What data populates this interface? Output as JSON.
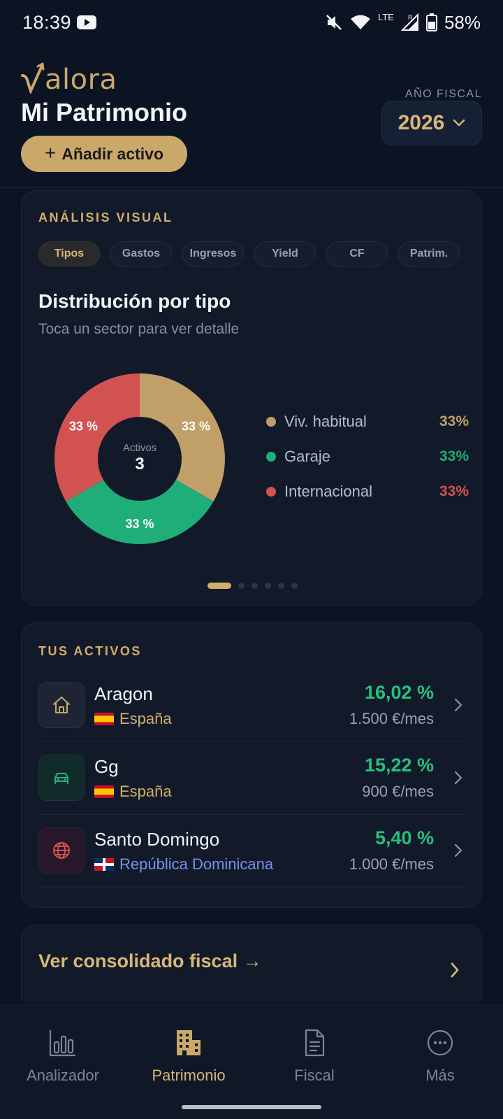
{
  "status_bar": {
    "time": "18:39",
    "network": "LTE",
    "roaming": "R",
    "battery": "58%"
  },
  "header": {
    "logo_text": "alora",
    "title": "Mi Patrimonio",
    "add_button": "Añadir activo",
    "fiscal_label": "AÑO FISCAL",
    "fiscal_year": "2026"
  },
  "analysis": {
    "section_label": "ANÁLISIS VISUAL",
    "tabs": [
      {
        "label": "Tipos",
        "active": true
      },
      {
        "label": "Gastos",
        "active": false
      },
      {
        "label": "Ingresos",
        "active": false
      },
      {
        "label": "Yield",
        "active": false
      },
      {
        "label": "CF",
        "active": false
      },
      {
        "label": "Patrim.",
        "active": false
      }
    ],
    "chart_title": "Distribución por tipo",
    "chart_subtitle": "Toca un sector para ver detalle",
    "center_label": "Activos",
    "center_value": "3",
    "page_count": 6,
    "active_page": 1
  },
  "chart_data": {
    "type": "pie",
    "donut": true,
    "title": "Distribución por tipo",
    "categories": [
      "Viv. habitual",
      "Garaje",
      "Internacional"
    ],
    "values": [
      33.33,
      33.33,
      33.33
    ],
    "labels": [
      "33 %",
      "33 %",
      "33 %"
    ],
    "legend_values": [
      "33%",
      "33%",
      "33%"
    ],
    "colors": [
      "#c0a068",
      "#1fae78",
      "#d25252"
    ],
    "legend_placement": "right"
  },
  "assets": {
    "section_label": "TUS ACTIVOS",
    "items": [
      {
        "name": "Aragon",
        "country": "España",
        "flag": "es",
        "icon": "house-icon",
        "yield": "16,02 %",
        "rent": "1.500 €/mes"
      },
      {
        "name": "Gg",
        "country": "España",
        "flag": "es",
        "icon": "car-icon",
        "yield": "15,22 %",
        "rent": "900 €/mes"
      },
      {
        "name": "Santo Domingo",
        "country": "República Dominicana",
        "flag": "do",
        "icon": "globe-icon",
        "yield": "5,40 %",
        "rent": "1.000 €/mes"
      }
    ]
  },
  "consolidado": {
    "link": "Ver consolidado fiscal →"
  },
  "nav": {
    "items": [
      {
        "label": "Analizador",
        "icon": "bar-chart-icon",
        "active": false
      },
      {
        "label": "Patrimonio",
        "icon": "building-icon",
        "active": true
      },
      {
        "label": "Fiscal",
        "icon": "document-icon",
        "active": false
      },
      {
        "label": "Más",
        "icon": "more-icon",
        "active": false
      }
    ]
  },
  "colors": {
    "background": "#0c1322",
    "card": "#121a2a",
    "accent_gold": "#d8b679",
    "positive_green": "#25c07f",
    "negative_red": "#d25252",
    "country_link_blue": "#7b8fe8"
  }
}
